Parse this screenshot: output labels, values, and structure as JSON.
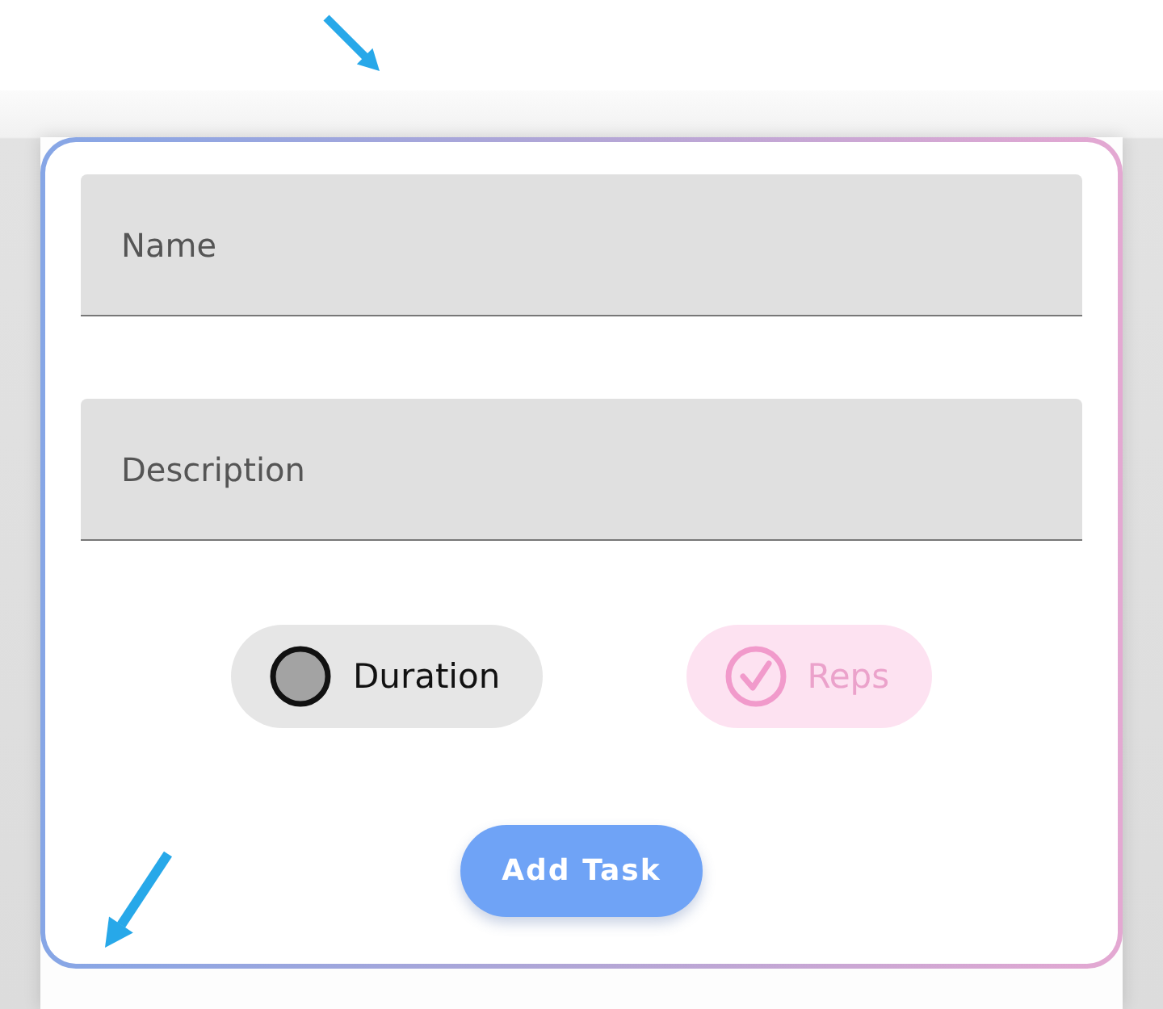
{
  "form": {
    "fields": [
      {
        "placeholder": "Name"
      },
      {
        "placeholder": "Description"
      }
    ],
    "options": [
      {
        "label": "Duration",
        "selected": false
      },
      {
        "label": "Reps",
        "selected": true
      }
    ],
    "submit": {
      "label": "Add Task"
    }
  }
}
